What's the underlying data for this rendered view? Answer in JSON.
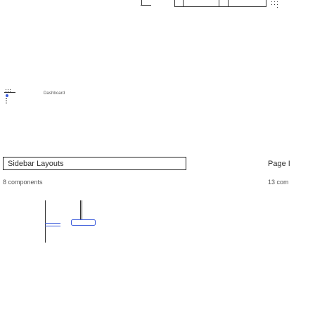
{
  "dashboard_card": {
    "label": "Dashboard"
  },
  "cards": [
    {
      "title": "Sidebar Layouts",
      "subtitle": "8 components"
    },
    {
      "title": "Page I",
      "subtitle": "13 com"
    }
  ],
  "colors": {
    "wire_stroke": "#333333",
    "accent_blue": "#3b5bdb"
  }
}
